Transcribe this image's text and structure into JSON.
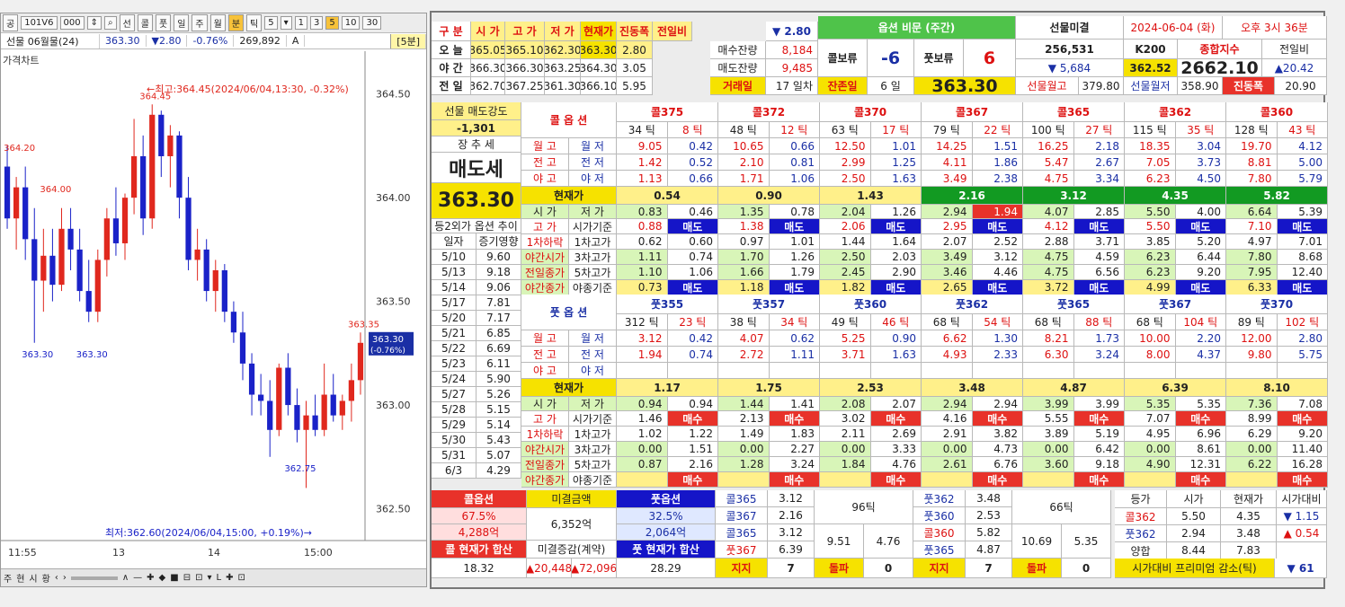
{
  "chart": {
    "toolbar": [
      "공",
      "101V6",
      "000",
      "⇕",
      "⌕",
      "선",
      "콜",
      "풋",
      "일",
      "주",
      "월",
      "분",
      "틱",
      "5",
      "▾",
      "1",
      "3",
      "5",
      "10",
      "30"
    ],
    "symbol": "선물 06월물(24)",
    "price": "363.30",
    "change": "▼2.80",
    "pct": "-0.76%",
    "volume": "269,892",
    "a": "A",
    "tf": "[5분]",
    "legend": "가격차트",
    "max_note": "←최고:364.45(2024/06/04,13:30, -0.32%)",
    "min_note": "최저:362.60(2024/06/04,15:00, +0.19%)→",
    "cur_line1": "363.30",
    "cur_line2": "(-0.76%)",
    "x_ticks": [
      "11:55",
      "13",
      "14",
      "15:00"
    ],
    "bottom": [
      "주",
      "현",
      "시",
      "황",
      "‹",
      "›",
      "∧",
      "—",
      "✚",
      "◆",
      "■",
      "⊟",
      "⊡",
      "▾",
      "L",
      "✚",
      "⊡"
    ],
    "colors": {
      "up": "#e0281e",
      "down": "#1a22c8",
      "accent": "#1a2fa5"
    }
  },
  "chart_data": {
    "type": "candlestick",
    "y_ticks": [
      364.5,
      364.0,
      363.5,
      363.0,
      362.5
    ],
    "ylim": [
      362.42,
      364.62
    ],
    "ohlc": [
      [
        364.15,
        364.25,
        363.85,
        363.9
      ],
      [
        363.9,
        364.1,
        363.75,
        364.05
      ],
      [
        364.05,
        364.15,
        363.7,
        363.8
      ],
      [
        363.8,
        363.95,
        363.3,
        363.6
      ],
      [
        363.6,
        363.85,
        363.45,
        363.72
      ],
      [
        363.72,
        363.85,
        363.5,
        363.58
      ],
      [
        363.58,
        363.95,
        363.55,
        363.85
      ],
      [
        363.85,
        363.95,
        363.65,
        363.75
      ],
      [
        363.75,
        363.85,
        363.5,
        363.55
      ],
      [
        363.55,
        363.7,
        363.4,
        363.45
      ],
      [
        363.45,
        363.75,
        363.4,
        363.7
      ],
      [
        363.7,
        363.95,
        363.62,
        363.9
      ],
      [
        363.9,
        364.05,
        363.72,
        363.78
      ],
      [
        363.78,
        364.02,
        363.7,
        364.0
      ],
      [
        364.0,
        364.38,
        363.92,
        364.2
      ],
      [
        364.2,
        364.3,
        363.82,
        363.9
      ],
      [
        363.9,
        364.45,
        363.85,
        364.4
      ],
      [
        364.4,
        364.42,
        364.1,
        364.2
      ],
      [
        364.2,
        364.35,
        364.05,
        364.3
      ],
      [
        364.3,
        364.32,
        363.9,
        364.0
      ],
      [
        364.0,
        364.1,
        363.65,
        363.7
      ],
      [
        363.7,
        363.85,
        363.6,
        363.75
      ],
      [
        363.75,
        363.8,
        363.5,
        363.55
      ],
      [
        363.55,
        363.7,
        363.45,
        363.65
      ],
      [
        363.65,
        363.68,
        363.4,
        363.45
      ],
      [
        363.45,
        363.5,
        363.3,
        363.35
      ],
      [
        363.35,
        363.45,
        363.12,
        363.2
      ],
      [
        363.2,
        363.25,
        362.95,
        363.05
      ],
      [
        363.05,
        363.15,
        362.95,
        363.02
      ],
      [
        363.02,
        363.12,
        362.75,
        362.88
      ],
      [
        362.88,
        363.2,
        362.85,
        363.18
      ],
      [
        363.18,
        363.25,
        362.95,
        363.0
      ],
      [
        363.0,
        363.08,
        362.82,
        362.88
      ],
      [
        362.88,
        363.02,
        362.6,
        362.95
      ],
      [
        362.95,
        363.05,
        362.85,
        362.88
      ],
      [
        362.88,
        363.2,
        362.85,
        363.05
      ],
      [
        363.05,
        363.15,
        362.92,
        362.95
      ],
      [
        362.95,
        363.05,
        362.88,
        363.02
      ],
      [
        363.02,
        363.2,
        362.92,
        363.12
      ],
      [
        363.12,
        363.35,
        363.05,
        363.3
      ]
    ],
    "labels": [
      {
        "i": 1,
        "p": 364.2,
        "t": "364.20"
      },
      {
        "i": 5,
        "p": 364.0,
        "t": "364.00"
      },
      {
        "i": 16,
        "p": 364.45,
        "t": "364.45"
      },
      {
        "i": 3,
        "p": 363.3,
        "t": "363.30"
      },
      {
        "i": 9,
        "p": 363.3,
        "t": "363.30"
      },
      {
        "i": 32,
        "p": 362.75,
        "t": "362.75"
      },
      {
        "i": 39,
        "p": 363.35,
        "t": "363.35"
      }
    ]
  },
  "panel": {
    "head": [
      "구 분",
      "시 가",
      "고 가",
      "저 가",
      "현재가",
      "진동폭",
      "전일비"
    ],
    "head_chg": "▼ 2.80",
    "rows": [
      [
        "오 늘",
        "365.05",
        "365.10",
        "362.30",
        "363.30",
        "2.80"
      ],
      [
        "야 간",
        "366.30",
        "366.30",
        "363.25",
        "364.30",
        "3.05"
      ],
      [
        "전 일",
        "362.70",
        "367.25",
        "361.30",
        "366.10",
        "5.95"
      ]
    ],
    "mini": [
      [
        "매수잔량",
        "8,184"
      ],
      [
        "매도잔량",
        "9,485"
      ],
      [
        "거래일",
        "17 일차"
      ]
    ],
    "title": "옵션 비문 (주간)",
    "call_gap": [
      "콜보류",
      "-6"
    ],
    "put_gap": [
      "풋보류",
      "6"
    ],
    "remain": [
      "잔존일",
      "6 일"
    ],
    "cur": "363.30",
    "right": {
      "fut_mig": "선물미결",
      "date": "2024-06-04 (화)",
      "time": "오후 3시 36분",
      "oi": "256,531",
      "oi_chg": "▼ 5,684",
      "k200": "K200",
      "k200v": "362.52",
      "comp": "종합지수",
      "compv": "2662.10",
      "prevd": "전일비",
      "prevdv": "▲20.42",
      "f_mig": "선물월고",
      "f_migv": "379.80",
      "f_low": "선물월저",
      "f_lowv": "358.90",
      "vib": "진동폭",
      "vibv": "20.90"
    },
    "left": {
      "sell_str": "선물 매도강도",
      "sell_v": "-1,301",
      "trend": "장 추 세",
      "trend_v": "매도세",
      "price": "363.30",
      "hist_title": "등2외가 옵션 추이",
      "hist_head": [
        "일자",
        "증기영향"
      ],
      "hist": [
        [
          "5/10",
          "9.60"
        ],
        [
          "5/13",
          "9.18"
        ],
        [
          "5/14",
          "9.06"
        ],
        [
          "5/17",
          "7.81"
        ],
        [
          "5/20",
          "7.17"
        ],
        [
          "5/21",
          "6.85"
        ],
        [
          "5/22",
          "6.69"
        ],
        [
          "5/23",
          "6.11"
        ],
        [
          "5/24",
          "5.90"
        ],
        [
          "5/27",
          "5.26"
        ],
        [
          "5/28",
          "5.15"
        ],
        [
          "5/29",
          "5.14"
        ],
        [
          "5/30",
          "5.43"
        ],
        [
          "5/31",
          "5.07"
        ],
        [
          "6/3",
          "4.29"
        ]
      ]
    },
    "call_label": "콜 옵 션",
    "put_label": "풋 옵 션",
    "cur_label": "현재가",
    "ev_labels": [
      [
        "월 고",
        "월 저"
      ],
      [
        "전 고",
        "전 저"
      ],
      [
        "야 고",
        "야 저"
      ]
    ],
    "cur_label_row": [
      "시 가",
      "저 가"
    ],
    "mid_labels": [
      [
        "고 가",
        "시가기준"
      ],
      [
        "1차하락",
        "1차고가"
      ],
      [
        "야간시가",
        "3차고가"
      ],
      [
        "전일종가",
        "5차고가"
      ],
      [
        "야간종가",
        "야종기준"
      ]
    ],
    "calls": [
      {
        "name": "콜375",
        "t1": "34 틱",
        "t2": "8 틱",
        "ev": [
          [
            "9.05",
            "0.42"
          ],
          [
            "1.42",
            "0.52"
          ],
          [
            "1.13",
            "0.66"
          ]
        ],
        "cur": "0.54",
        "m": [
          [
            "0.83",
            "0.46"
          ],
          [
            "0.88",
            "매도"
          ],
          [
            "0.62",
            "0.60"
          ],
          [
            "1.11",
            "0.74"
          ],
          [
            "1.10",
            "1.06"
          ],
          [
            "0.73",
            "매도"
          ]
        ]
      },
      {
        "name": "콜372",
        "t1": "48 틱",
        "t2": "12 틱",
        "ev": [
          [
            "10.65",
            "0.66"
          ],
          [
            "2.10",
            "0.81"
          ],
          [
            "1.71",
            "1.06"
          ]
        ],
        "cur": "0.90",
        "m": [
          [
            "1.35",
            "0.78"
          ],
          [
            "1.38",
            "매도"
          ],
          [
            "0.97",
            "1.01"
          ],
          [
            "1.70",
            "1.26"
          ],
          [
            "1.66",
            "1.79"
          ],
          [
            "1.18",
            "매도"
          ]
        ]
      },
      {
        "name": "콜370",
        "t1": "63 틱",
        "t2": "17 틱",
        "ev": [
          [
            "12.50",
            "1.01"
          ],
          [
            "2.99",
            "1.25"
          ],
          [
            "2.50",
            "1.63"
          ]
        ],
        "cur": "1.43",
        "m": [
          [
            "2.04",
            "1.26"
          ],
          [
            "2.06",
            "매도"
          ],
          [
            "1.44",
            "1.64"
          ],
          [
            "2.50",
            "2.03"
          ],
          [
            "2.45",
            "2.90"
          ],
          [
            "1.82",
            "매도"
          ]
        ]
      },
      {
        "name": "콜367",
        "t1": "79 틱",
        "t2": "22 틱",
        "ev": [
          [
            "14.25",
            "1.51"
          ],
          [
            "4.11",
            "1.86"
          ],
          [
            "3.49",
            "2.38"
          ]
        ],
        "cur": "2.16",
        "m": [
          [
            "2.94",
            "1.94"
          ],
          [
            "2.95",
            "매도"
          ],
          [
            "2.07",
            "2.52"
          ],
          [
            "3.49",
            "3.12"
          ],
          [
            "3.46",
            "4.46"
          ],
          [
            "2.65",
            "매도"
          ]
        ]
      },
      {
        "name": "콜365",
        "t1": "100 틱",
        "t2": "27 틱",
        "ev": [
          [
            "16.25",
            "2.18"
          ],
          [
            "5.47",
            "2.67"
          ],
          [
            "4.75",
            "3.34"
          ]
        ],
        "cur": "3.12",
        "m": [
          [
            "4.07",
            "2.85"
          ],
          [
            "4.12",
            "매도"
          ],
          [
            "2.88",
            "3.71"
          ],
          [
            "4.75",
            "4.59"
          ],
          [
            "4.75",
            "6.56"
          ],
          [
            "3.72",
            "매도"
          ]
        ]
      },
      {
        "name": "콜362",
        "t1": "115 틱",
        "t2": "35 틱",
        "ev": [
          [
            "18.35",
            "3.04"
          ],
          [
            "7.05",
            "3.73"
          ],
          [
            "6.23",
            "4.50"
          ]
        ],
        "cur": "4.35",
        "m": [
          [
            "5.50",
            "4.00"
          ],
          [
            "5.50",
            "매도"
          ],
          [
            "3.85",
            "5.20"
          ],
          [
            "6.23",
            "6.44"
          ],
          [
            "6.23",
            "9.20"
          ],
          [
            "4.99",
            "매도"
          ]
        ]
      },
      {
        "name": "콜360",
        "t1": "128 틱",
        "t2": "43 틱",
        "ev": [
          [
            "19.70",
            "4.12"
          ],
          [
            "8.81",
            "5.00"
          ],
          [
            "7.80",
            "5.79"
          ]
        ],
        "cur": "5.82",
        "m": [
          [
            "6.64",
            "5.39"
          ],
          [
            "7.10",
            "매도"
          ],
          [
            "4.97",
            "7.01"
          ],
          [
            "7.80",
            "8.68"
          ],
          [
            "7.95",
            "12.40"
          ],
          [
            "6.33",
            "매도"
          ]
        ]
      }
    ],
    "puts": [
      {
        "name": "풋355",
        "t1": "312 틱",
        "t2": "23 틱",
        "ev": [
          [
            "3.12",
            "0.42"
          ],
          [
            "1.94",
            "0.74"
          ],
          [
            "",
            ""
          ]
        ],
        "cur": "1.17",
        "m": [
          [
            "0.94",
            "0.94"
          ],
          [
            "1.46",
            "매수"
          ],
          [
            "1.02",
            "1.22"
          ],
          [
            "0.00",
            "1.51"
          ],
          [
            "0.87",
            "2.16"
          ],
          [
            "",
            "매수"
          ]
        ]
      },
      {
        "name": "풋357",
        "t1": "38 틱",
        "t2": "34 틱",
        "ev": [
          [
            "4.07",
            "0.62"
          ],
          [
            "2.72",
            "1.11"
          ],
          [
            "",
            ""
          ]
        ],
        "cur": "1.75",
        "m": [
          [
            "1.44",
            "1.41"
          ],
          [
            "2.13",
            "매수"
          ],
          [
            "1.49",
            "1.83"
          ],
          [
            "0.00",
            "2.27"
          ],
          [
            "1.28",
            "3.24"
          ],
          [
            "",
            "매수"
          ]
        ]
      },
      {
        "name": "풋360",
        "t1": "49 틱",
        "t2": "46 틱",
        "ev": [
          [
            "5.25",
            "0.90"
          ],
          [
            "3.71",
            "1.63"
          ],
          [
            "",
            ""
          ]
        ],
        "cur": "2.53",
        "m": [
          [
            "2.08",
            "2.07"
          ],
          [
            "3.02",
            "매수"
          ],
          [
            "2.11",
            "2.69"
          ],
          [
            "0.00",
            "3.33"
          ],
          [
            "1.84",
            "4.76"
          ],
          [
            "",
            "매수"
          ]
        ]
      },
      {
        "name": "풋362",
        "t1": "68 틱",
        "t2": "54 틱",
        "ev": [
          [
            "6.62",
            "1.30"
          ],
          [
            "4.93",
            "2.33"
          ],
          [
            "",
            ""
          ]
        ],
        "cur": "3.48",
        "m": [
          [
            "2.94",
            "2.94"
          ],
          [
            "4.16",
            "매수"
          ],
          [
            "2.91",
            "3.82"
          ],
          [
            "0.00",
            "4.73"
          ],
          [
            "2.61",
            "6.76"
          ],
          [
            "",
            "매수"
          ]
        ]
      },
      {
        "name": "풋365",
        "t1": "68 틱",
        "t2": "88 틱",
        "ev": [
          [
            "8.21",
            "1.73"
          ],
          [
            "6.30",
            "3.24"
          ],
          [
            "",
            ""
          ]
        ],
        "cur": "4.87",
        "m": [
          [
            "3.99",
            "3.99"
          ],
          [
            "5.55",
            "매수"
          ],
          [
            "3.89",
            "5.19"
          ],
          [
            "0.00",
            "6.42"
          ],
          [
            "3.60",
            "9.18"
          ],
          [
            "",
            "매수"
          ]
        ]
      },
      {
        "name": "풋367",
        "t1": "68 틱",
        "t2": "104 틱",
        "ev": [
          [
            "10.00",
            "2.20"
          ],
          [
            "8.00",
            "4.37"
          ],
          [
            "",
            ""
          ]
        ],
        "cur": "6.39",
        "m": [
          [
            "5.35",
            "5.35"
          ],
          [
            "7.07",
            "매수"
          ],
          [
            "4.95",
            "6.96"
          ],
          [
            "0.00",
            "8.61"
          ],
          [
            "4.90",
            "12.31"
          ],
          [
            "",
            "매수"
          ]
        ]
      },
      {
        "name": "풋370",
        "t1": "89 틱",
        "t2": "102 틱",
        "ev": [
          [
            "12.00",
            "2.80"
          ],
          [
            "9.80",
            "5.75"
          ],
          [
            "",
            ""
          ]
        ],
        "cur": "8.10",
        "m": [
          [
            "7.36",
            "7.08"
          ],
          [
            "8.99",
            "매수"
          ],
          [
            "6.29",
            "9.20"
          ],
          [
            "0.00",
            "11.40"
          ],
          [
            "6.22",
            "16.28"
          ],
          [
            "",
            "매수"
          ]
        ]
      }
    ],
    "bottom": {
      "h": [
        "콜옵션",
        "미결금액",
        "풋옵션"
      ],
      "cpct": "67.5%",
      "camt": "4,288억",
      "mig": "6,352억",
      "ppct": "32.5%",
      "pamt": "2,064억",
      "csum_l": "콜 현재가 합산",
      "mig2": "미결증감(계약)",
      "psum_l": "풋 현재가 합산",
      "csum": "18.32",
      "m2a": "▲20,448",
      "m2b": "▲72,096",
      "psum": "28.29",
      "p1": [
        [
          "콜365",
          "3.12"
        ],
        [
          "콜367",
          "2.16"
        ],
        [
          "콜365",
          "3.12"
        ],
        [
          "풋367",
          "6.39"
        ]
      ],
      "p1t": "96틱",
      "p1a": "9.51",
      "p1b": "4.76",
      "p2": [
        [
          "풋362",
          "3.48"
        ],
        [
          "풋360",
          "2.53"
        ],
        [
          "콜360",
          "5.82"
        ],
        [
          "풋365",
          "4.87"
        ]
      ],
      "p2t": "66틱",
      "p2a": "10.69",
      "p2b": "5.35",
      "sr": [
        "지지",
        "7",
        "돌파",
        "0",
        "지지",
        "7",
        "돌파",
        "0"
      ],
      "tbl_h": [
        "등가",
        "시가",
        "현재가",
        "시가대비"
      ],
      "tbl": [
        [
          "콜362",
          "5.50",
          "4.35",
          "▼ 1.15"
        ],
        [
          "풋362",
          "2.94",
          "3.48",
          "▲ 0.54"
        ],
        [
          "양합",
          "8.44",
          "7.83",
          ""
        ]
      ],
      "note": "시가대비 프리미엄 감소(틱)",
      "note_v": "▼ 61"
    }
  }
}
